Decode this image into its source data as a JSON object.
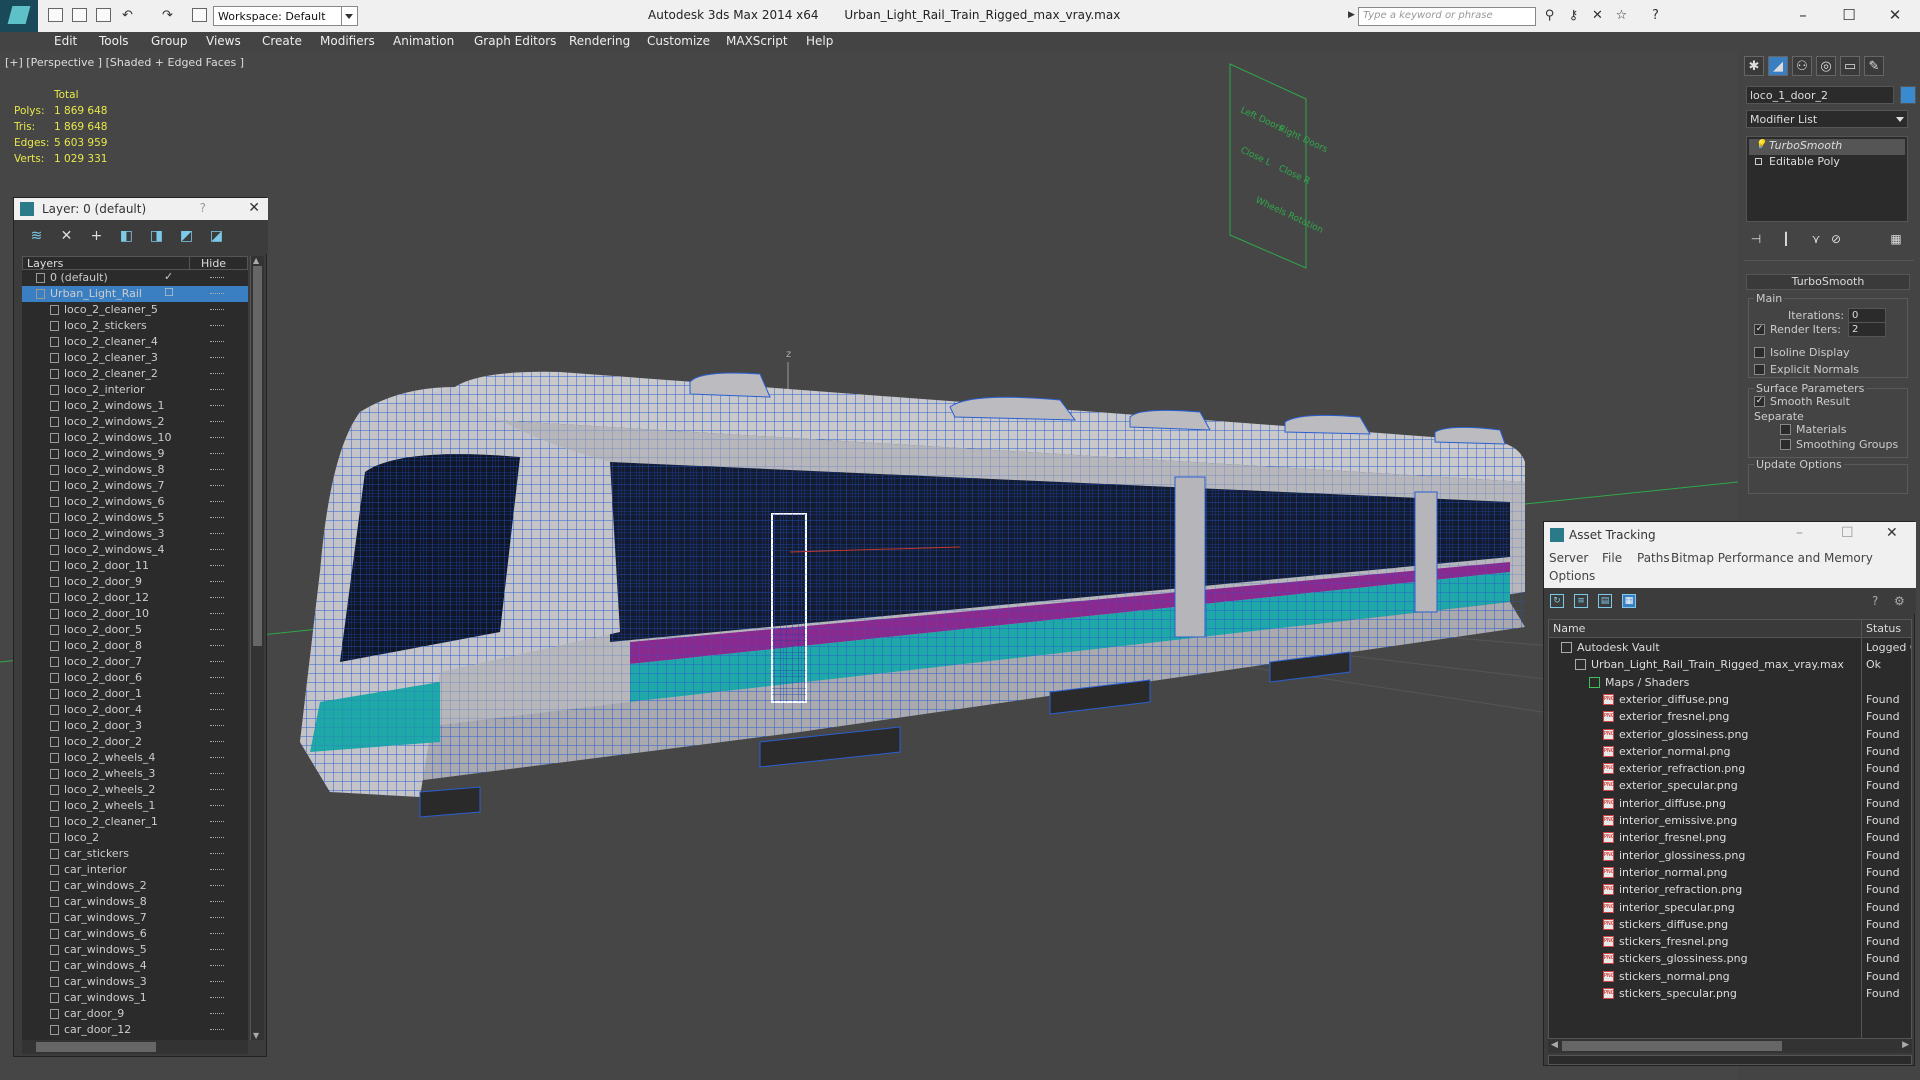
{
  "titlebar": {
    "workspace": "Workspace: Default",
    "app_name": "Autodesk 3ds Max  2014 x64",
    "file_name": "Urban_Light_Rail_Train_Rigged_max_vray.max",
    "search_placeholder": "Type a keyword or phrase"
  },
  "menu": [
    "Edit",
    "Tools",
    "Group",
    "Views",
    "Create",
    "Modifiers",
    "Animation",
    "Graph Editors",
    "Rendering",
    "Customize",
    "MAXScript",
    "Help"
  ],
  "viewport": {
    "label": "[+] [Perspective ] [Shaded + Edged Faces ]",
    "stats_header": "Total",
    "stats": [
      {
        "label": "Polys:",
        "value": "1 869 648"
      },
      {
        "label": "Tris:",
        "value": "1 869 648"
      },
      {
        "label": "Edges:",
        "value": "5 603 959"
      },
      {
        "label": "Verts:",
        "value": "1 029 331"
      }
    ],
    "sign_texts": [
      "Left Doors",
      "Right Doors",
      "Close L",
      "Close R",
      "Wheels Rotation"
    ],
    "gizmo_label": "z"
  },
  "layer_panel": {
    "title": "Layer: 0 (default)",
    "help": "?",
    "col_layers": "Layers",
    "col_hide": "Hide",
    "items": [
      {
        "name": "0 (default)",
        "level": 1,
        "type": "layer"
      },
      {
        "name": "Urban_Light_Rail",
        "level": 1,
        "type": "layer",
        "selected": true
      },
      {
        "name": "loco_2_cleaner_5",
        "level": 2
      },
      {
        "name": "loco_2_stickers",
        "level": 2
      },
      {
        "name": "loco_2_cleaner_4",
        "level": 2
      },
      {
        "name": "loco_2_cleaner_3",
        "level": 2
      },
      {
        "name": "loco_2_cleaner_2",
        "level": 2
      },
      {
        "name": "loco_2_interior",
        "level": 2
      },
      {
        "name": "loco_2_windows_1",
        "level": 2
      },
      {
        "name": "loco_2_windows_2",
        "level": 2
      },
      {
        "name": "loco_2_windows_10",
        "level": 2
      },
      {
        "name": "loco_2_windows_9",
        "level": 2
      },
      {
        "name": "loco_2_windows_8",
        "level": 2
      },
      {
        "name": "loco_2_windows_7",
        "level": 2
      },
      {
        "name": "loco_2_windows_6",
        "level": 2
      },
      {
        "name": "loco_2_windows_5",
        "level": 2
      },
      {
        "name": "loco_2_windows_3",
        "level": 2
      },
      {
        "name": "loco_2_windows_4",
        "level": 2
      },
      {
        "name": "loco_2_door_11",
        "level": 2
      },
      {
        "name": "loco_2_door_9",
        "level": 2
      },
      {
        "name": "loco_2_door_12",
        "level": 2
      },
      {
        "name": "loco_2_door_10",
        "level": 2
      },
      {
        "name": "loco_2_door_5",
        "level": 2
      },
      {
        "name": "loco_2_door_8",
        "level": 2
      },
      {
        "name": "loco_2_door_7",
        "level": 2
      },
      {
        "name": "loco_2_door_6",
        "level": 2
      },
      {
        "name": "loco_2_door_1",
        "level": 2
      },
      {
        "name": "loco_2_door_4",
        "level": 2
      },
      {
        "name": "loco_2_door_3",
        "level": 2
      },
      {
        "name": "loco_2_door_2",
        "level": 2
      },
      {
        "name": "loco_2_wheels_4",
        "level": 2
      },
      {
        "name": "loco_2_wheels_3",
        "level": 2
      },
      {
        "name": "loco_2_wheels_2",
        "level": 2
      },
      {
        "name": "loco_2_wheels_1",
        "level": 2
      },
      {
        "name": "loco_2_cleaner_1",
        "level": 2
      },
      {
        "name": "loco_2",
        "level": 2
      },
      {
        "name": "car_stickers",
        "level": 2
      },
      {
        "name": "car_interior",
        "level": 2
      },
      {
        "name": "car_windows_2",
        "level": 2
      },
      {
        "name": "car_windows_8",
        "level": 2
      },
      {
        "name": "car_windows_7",
        "level": 2
      },
      {
        "name": "car_windows_6",
        "level": 2
      },
      {
        "name": "car_windows_5",
        "level": 2
      },
      {
        "name": "car_windows_4",
        "level": 2
      },
      {
        "name": "car_windows_3",
        "level": 2
      },
      {
        "name": "car_windows_1",
        "level": 2
      },
      {
        "name": "car_door_9",
        "level": 2
      },
      {
        "name": "car_door_12",
        "level": 2
      }
    ]
  },
  "command_panel": {
    "object_name": "loco_1_door_2",
    "modifier_list": "Modifier List",
    "stack": [
      "TurboSmooth",
      "Editable Poly"
    ],
    "rollout_title": "TurboSmooth",
    "main_label": "Main",
    "iterations_label": "Iterations:",
    "iterations_value": "0",
    "render_iters_label": "Render Iters:",
    "render_iters_value": "2",
    "isoline": "Isoline Display",
    "explicit_normals": "Explicit Normals",
    "surface_params": "Surface Parameters",
    "smooth_result": "Smooth Result",
    "separate": "Separate",
    "materials": "Materials",
    "smoothing_groups": "Smoothing Groups",
    "update_options": "Update Options"
  },
  "asset_tracking": {
    "title": "Asset Tracking",
    "menu": [
      "Server",
      "File",
      "Paths",
      "Bitmap Performance and Memory",
      "Options"
    ],
    "col_name": "Name",
    "col_status": "Status",
    "rows": [
      {
        "name": "Autodesk Vault",
        "status": "Logged C",
        "level": 0,
        "icon": "vault"
      },
      {
        "name": "Urban_Light_Rail_Train_Rigged_max_vray.max",
        "status": "Ok",
        "level": 1,
        "icon": "max"
      },
      {
        "name": "Maps / Shaders",
        "status": "",
        "level": 2,
        "icon": "folder"
      },
      {
        "name": "exterior_diffuse.png",
        "status": "Found",
        "level": 3,
        "icon": "png"
      },
      {
        "name": "exterior_fresnel.png",
        "status": "Found",
        "level": 3,
        "icon": "png"
      },
      {
        "name": "exterior_glossiness.png",
        "status": "Found",
        "level": 3,
        "icon": "png"
      },
      {
        "name": "exterior_normal.png",
        "status": "Found",
        "level": 3,
        "icon": "png"
      },
      {
        "name": "exterior_refraction.png",
        "status": "Found",
        "level": 3,
        "icon": "png"
      },
      {
        "name": "exterior_specular.png",
        "status": "Found",
        "level": 3,
        "icon": "png"
      },
      {
        "name": "interior_diffuse.png",
        "status": "Found",
        "level": 3,
        "icon": "png"
      },
      {
        "name": "interior_emissive.png",
        "status": "Found",
        "level": 3,
        "icon": "png"
      },
      {
        "name": "interior_fresnel.png",
        "status": "Found",
        "level": 3,
        "icon": "png"
      },
      {
        "name": "interior_glossiness.png",
        "status": "Found",
        "level": 3,
        "icon": "png"
      },
      {
        "name": "interior_normal.png",
        "status": "Found",
        "level": 3,
        "icon": "png"
      },
      {
        "name": "interior_refraction.png",
        "status": "Found",
        "level": 3,
        "icon": "png"
      },
      {
        "name": "interior_specular.png",
        "status": "Found",
        "level": 3,
        "icon": "png"
      },
      {
        "name": "stickers_diffuse.png",
        "status": "Found",
        "level": 3,
        "icon": "png"
      },
      {
        "name": "stickers_fresnel.png",
        "status": "Found",
        "level": 3,
        "icon": "png"
      },
      {
        "name": "stickers_glossiness.png",
        "status": "Found",
        "level": 3,
        "icon": "png"
      },
      {
        "name": "stickers_normal.png",
        "status": "Found",
        "level": 3,
        "icon": "png"
      },
      {
        "name": "stickers_specular.png",
        "status": "Found",
        "level": 3,
        "icon": "png"
      }
    ]
  },
  "colors": {
    "stats": "#e8e84a",
    "selection": "#3a7fc1",
    "wire": "#2a5fd0",
    "accent": "#5ec1c7"
  }
}
